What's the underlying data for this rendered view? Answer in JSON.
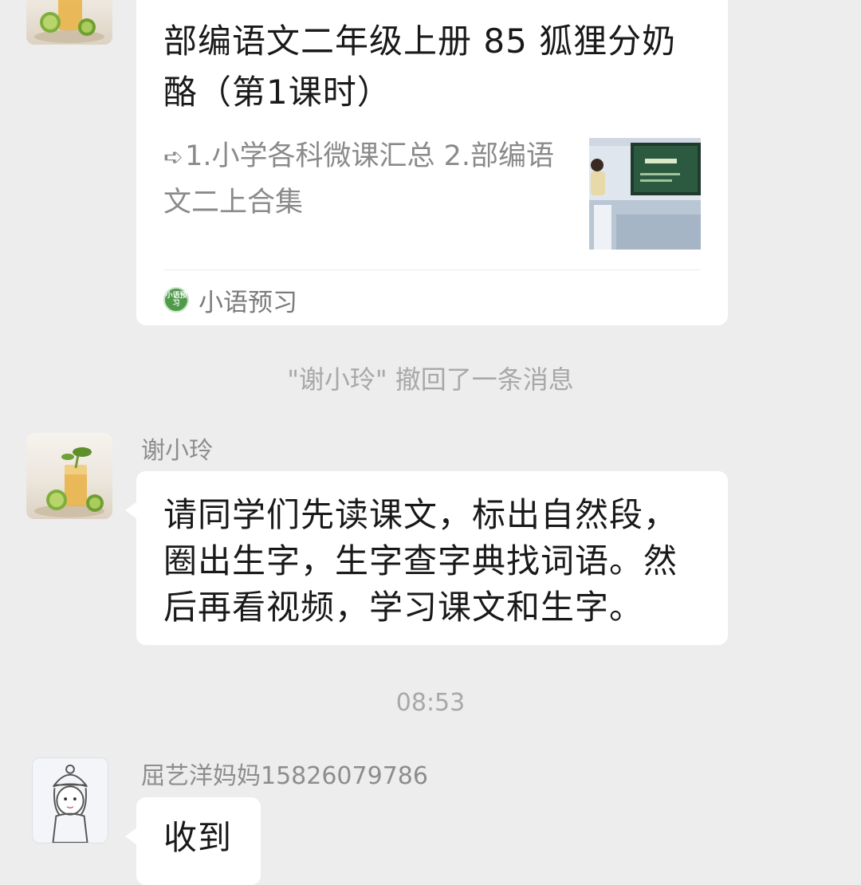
{
  "chat": {
    "messages": [
      {
        "type": "link-card",
        "title": "部编语文二年级上册 85 狐狸分奶酪（第1课时）",
        "description_icon": "share-arrow-icon",
        "description": "1.小学各科微课汇总   2.部编语文二上合集",
        "source": {
          "name": "小语预习",
          "logo_text": "小语预习"
        }
      },
      {
        "type": "system",
        "text": "\"谢小玲\" 撤回了一条消息"
      },
      {
        "type": "text",
        "sender": "谢小玲",
        "avatar": "lemon-drink-avatar",
        "text": "请同学们先读课文，标出自然段，圈出生字，生字查字典找词语。然后再看视频，学习课文和生字。"
      },
      {
        "type": "time",
        "text": "08:53"
      },
      {
        "type": "text",
        "sender": "屈艺洋妈妈15826079786",
        "avatar": "cartoon-girl-avatar",
        "text": "收到"
      }
    ]
  },
  "colors": {
    "background": "#ededed",
    "bubble": "#ffffff",
    "primary_text": "#191919",
    "secondary_text": "#8a8a8a",
    "system_text": "#a8a8a8",
    "source_logo": "#4f9a4b"
  }
}
